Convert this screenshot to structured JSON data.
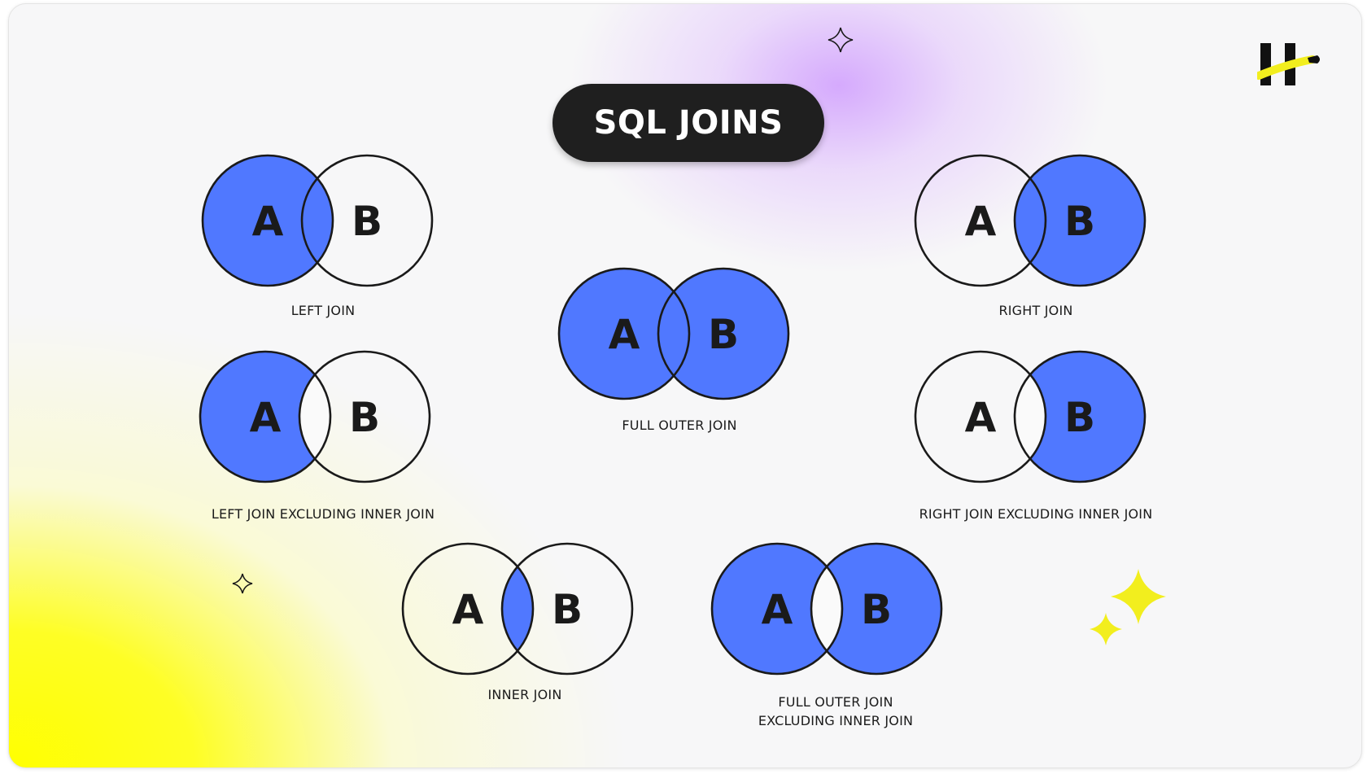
{
  "title": "SQL JOINS",
  "colors": {
    "fill": "#5078ff",
    "outline": "#1a1a1a",
    "title_background": "#1f1f1f",
    "logo_accent": "#f2ee1e",
    "sparkle_yellow": "#f2ee1e"
  },
  "icons": [
    "brand-logo-icon",
    "sparkle-icon"
  ],
  "diagrams": [
    {
      "id": "left-join",
      "label_a": "A",
      "label_b": "B",
      "caption": "LEFT JOIN",
      "shaded": [
        "a_only",
        "intersection"
      ]
    },
    {
      "id": "right-join",
      "label_a": "A",
      "label_b": "B",
      "caption": "RIGHT JOIN",
      "shaded": [
        "intersection",
        "b_only"
      ]
    },
    {
      "id": "full-outer-join",
      "label_a": "A",
      "label_b": "B",
      "caption": "FULL OUTER JOIN",
      "shaded": [
        "a_only",
        "intersection",
        "b_only"
      ]
    },
    {
      "id": "left-join-excluding-inner-join",
      "label_a": "A",
      "label_b": "B",
      "caption": "LEFT JOIN EXCLUDING INNER JOIN",
      "shaded": [
        "a_only"
      ]
    },
    {
      "id": "right-join-excluding-inner-join",
      "label_a": "A",
      "label_b": "B",
      "caption": "RIGHT JOIN EXCLUDING INNER JOIN",
      "shaded": [
        "b_only"
      ]
    },
    {
      "id": "inner-join",
      "label_a": "A",
      "label_b": "B",
      "caption": "INNER JOIN",
      "shaded": [
        "intersection"
      ]
    },
    {
      "id": "full-outer-join-excluding-inner-join",
      "label_a": "A",
      "label_b": "B",
      "caption_line1": "FULL OUTER JOIN",
      "caption_line2": "EXCLUDING INNER JOIN",
      "shaded": [
        "a_only",
        "b_only"
      ]
    }
  ]
}
